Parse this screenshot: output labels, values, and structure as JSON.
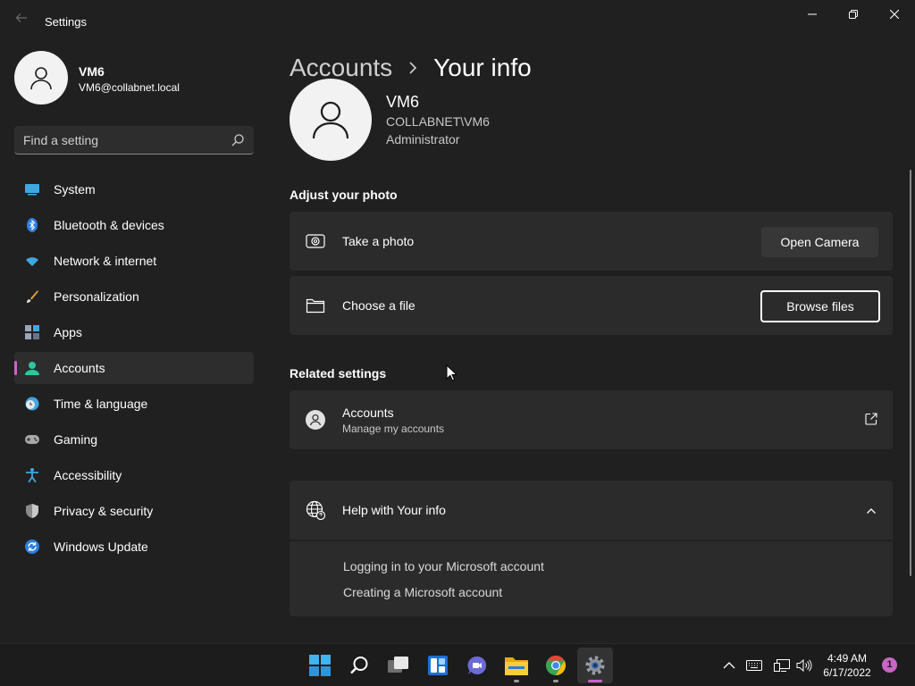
{
  "window": {
    "title": "Settings",
    "back_icon": "back-arrow-icon",
    "minimize_icon": "minimize-icon",
    "maximize_icon": "restore-icon",
    "close_icon": "close-icon"
  },
  "sidebar": {
    "profile": {
      "name": "VM6",
      "email": "VM6@collabnet.local",
      "avatar_icon": "user-avatar-icon"
    },
    "search": {
      "placeholder": "Find a setting",
      "value": "",
      "icon": "search-icon"
    },
    "items": [
      {
        "label": "System",
        "icon": "system-icon",
        "active": false
      },
      {
        "label": "Bluetooth & devices",
        "icon": "bluetooth-icon",
        "active": false
      },
      {
        "label": "Network & internet",
        "icon": "wifi-icon",
        "active": false
      },
      {
        "label": "Personalization",
        "icon": "brush-icon",
        "active": false
      },
      {
        "label": "Apps",
        "icon": "apps-icon",
        "active": false
      },
      {
        "label": "Accounts",
        "icon": "accounts-icon",
        "active": true
      },
      {
        "label": "Time & language",
        "icon": "clock-globe-icon",
        "active": false
      },
      {
        "label": "Gaming",
        "icon": "gamepad-icon",
        "active": false
      },
      {
        "label": "Accessibility",
        "icon": "accessibility-icon",
        "active": false
      },
      {
        "label": "Privacy & security",
        "icon": "shield-icon",
        "active": false
      },
      {
        "label": "Windows Update",
        "icon": "update-icon",
        "active": false
      }
    ]
  },
  "main": {
    "breadcrumb": {
      "parent": "Accounts",
      "current": "Your info"
    },
    "user": {
      "name": "VM6",
      "domain": "COLLABNET\\VM6",
      "role": "Administrator"
    },
    "adjust_photo": {
      "title": "Adjust your photo",
      "take_photo": {
        "label": "Take a photo",
        "icon": "camera-icon",
        "button": "Open Camera"
      },
      "choose_file": {
        "label": "Choose a file",
        "icon": "folder-icon",
        "button": "Browse files"
      }
    },
    "related": {
      "title": "Related settings",
      "accounts": {
        "label": "Accounts",
        "sublabel": "Manage my accounts",
        "icon": "person-circle-icon",
        "action_icon": "external-link-icon"
      }
    },
    "help": {
      "title": "Help with Your info",
      "icon": "globe-help-icon",
      "toggle_icon": "chevron-up-icon",
      "links": [
        "Logging in to your Microsoft account",
        "Creating a Microsoft account"
      ]
    }
  },
  "taskbar": {
    "apps": [
      "windows-start-icon",
      "search-icon",
      "task-view-icon",
      "widgets-icon",
      "teams-chat-icon",
      "file-explorer-icon",
      "chrome-icon",
      "settings-gear-icon"
    ],
    "tray": [
      "chevron-up-icon",
      "keyboard-icon",
      "network-icon",
      "volume-icon"
    ],
    "time": "4:49 AM",
    "date": "6/17/2022",
    "notifications": "1"
  },
  "colors": {
    "accent": "#c865c5",
    "background": "#202020",
    "card": "#2b2b2b"
  }
}
